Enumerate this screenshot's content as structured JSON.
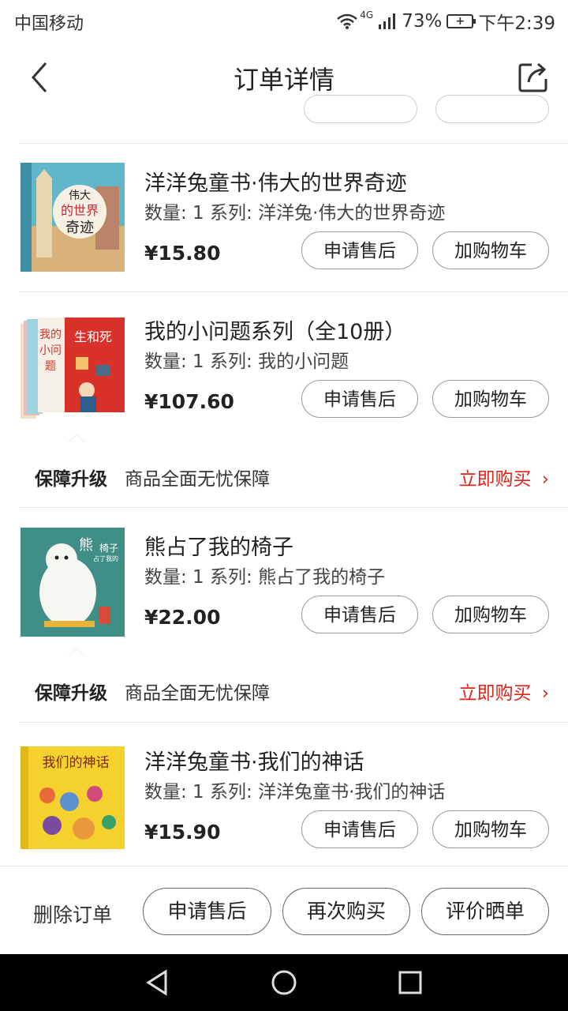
{
  "status_bar": {
    "carrier": "中国移动",
    "network": "4G",
    "battery": "73%",
    "time": "下午2:39",
    "icons": [
      "wifi-icon",
      "signal-icon",
      "battery-charging-icon"
    ]
  },
  "header": {
    "title": "订单详情",
    "back_icon": "chevron-left-icon",
    "share_icon": "share-icon"
  },
  "items": [
    {
      "title": "洋洋兔童书·伟大的世界奇迹",
      "meta": "数量: 1 系列: 洋洋兔·伟大的世界奇迹",
      "price": "¥15.80",
      "after_sale": "申请售后",
      "add_cart": "加购物车",
      "cover_text": [
        "伟大",
        "的世界",
        "奇迹"
      ]
    },
    {
      "title": "我的小问题系列（全10册）",
      "meta": "数量: 1 系列: 我的小问题",
      "price": "¥107.60",
      "after_sale": "申请售后",
      "add_cart": "加购物车",
      "cover_text": [
        "我的",
        "小问",
        "题",
        "生和死"
      ]
    },
    {
      "title": "熊占了我的椅子",
      "meta": "数量: 1 系列: 熊占了我的椅子",
      "price": "¥22.00",
      "after_sale": "申请售后",
      "add_cart": "加购物车",
      "cover_text": [
        "熊",
        "占了我的",
        "椅子"
      ]
    },
    {
      "title": "洋洋兔童书·我们的神话",
      "meta": "数量: 1 系列: 洋洋兔童书·我们的神话",
      "price": "¥15.90",
      "after_sale": "申请售后",
      "add_cart": "加购物车",
      "cover_text": [
        "我们的神话"
      ]
    }
  ],
  "guarantee": {
    "title": "保障升级",
    "desc": "商品全面无忧保障",
    "link": "立即购买",
    "link_icon": "chevron-right-icon"
  },
  "bottom_bar": {
    "delete": "删除订单",
    "after_sale": "申请售后",
    "buy_again": "再次购买",
    "review": "评价晒单"
  },
  "colors": {
    "accent": "#e2231a",
    "text": "#222222",
    "border": "#999999"
  }
}
